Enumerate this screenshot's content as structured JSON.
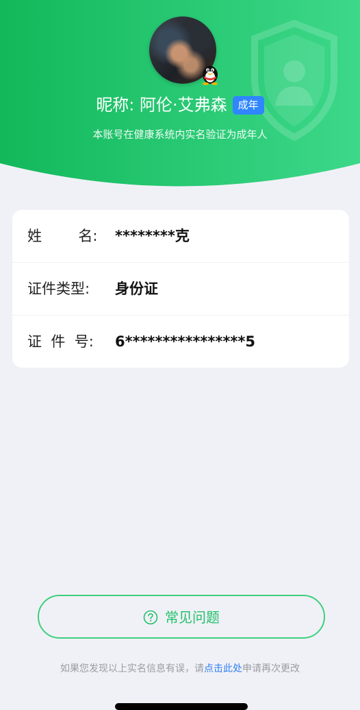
{
  "header": {
    "nickname_prefix": "昵称: ",
    "nickname": "阿伦·艾弗森",
    "badge": "成年",
    "verify_text": "本账号在健康系统内实名验证为成年人",
    "avatar_icon": "user-avatar",
    "qq_icon": "qq-penguin-icon",
    "shield_icon": "shield-user-icon",
    "colors": {
      "gradient_start": "#12b85a",
      "gradient_end": "#3dd88a",
      "badge": "#2f86ff"
    }
  },
  "info": {
    "rows": [
      {
        "label": "姓        名:",
        "value": "********克"
      },
      {
        "label": "证件类型:",
        "value": "身份证"
      },
      {
        "label": "证  件  号:",
        "value": "6****************5"
      }
    ]
  },
  "faq": {
    "label": "常见问题",
    "icon": "question-circle-icon",
    "color": "#22c06b"
  },
  "footer": {
    "prefix": "如果您发现以上实名信息有误，请",
    "link": "点击此处",
    "suffix": "申请再次更改",
    "link_color": "#2f7ef5"
  }
}
